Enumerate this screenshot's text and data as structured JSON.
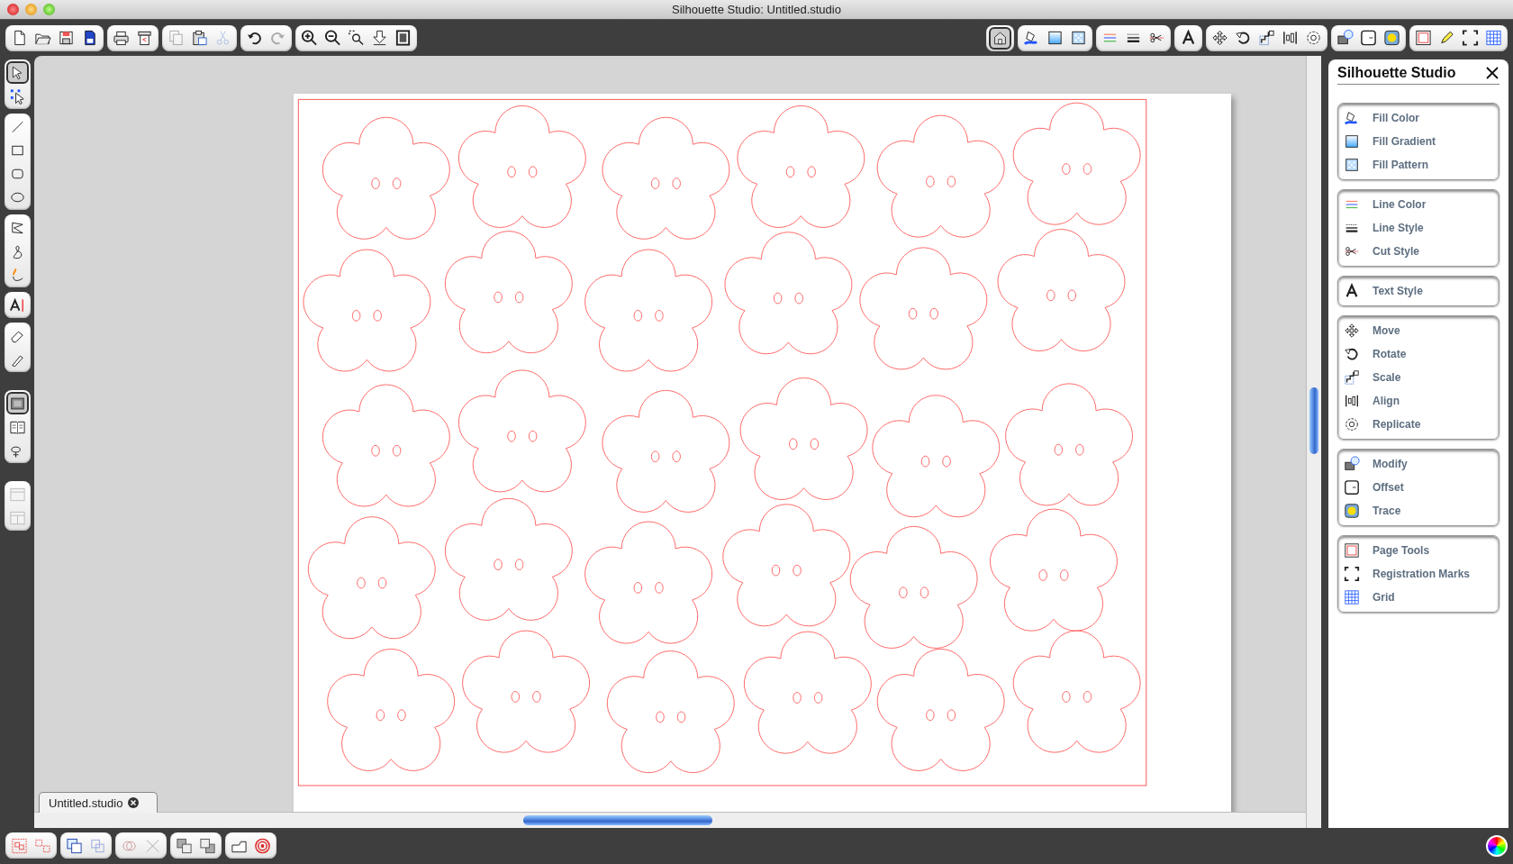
{
  "window": {
    "title": "Silhouette Studio: Untitled.studio"
  },
  "toolbar": {
    "left_groups": [
      [
        {
          "kind": "new",
          "disabled": false
        },
        {
          "kind": "open",
          "disabled": false
        },
        {
          "kind": "save",
          "disabled": false
        },
        {
          "kind": "card",
          "disabled": false
        }
      ],
      [
        {
          "kind": "print",
          "disabled": false
        },
        {
          "kind": "cutter",
          "disabled": false
        }
      ],
      [
        {
          "kind": "copy",
          "disabled": true
        },
        {
          "kind": "paste",
          "disabled": false
        },
        {
          "kind": "cut",
          "disabled": true
        }
      ],
      [
        {
          "kind": "undo",
          "disabled": false
        },
        {
          "kind": "redo",
          "disabled": true
        }
      ],
      [
        {
          "kind": "zoom-in",
          "disabled": false
        },
        {
          "kind": "zoom-out",
          "disabled": false
        },
        {
          "kind": "zoom-area",
          "disabled": false
        },
        {
          "kind": "pan",
          "disabled": false
        },
        {
          "kind": "fit",
          "disabled": false
        }
      ]
    ],
    "right_groups": [
      [
        {
          "kind": "home",
          "selected": true
        }
      ],
      [
        {
          "kind": "fill-color",
          "selected": false
        },
        {
          "kind": "fill-gradient",
          "selected": false
        },
        {
          "kind": "fill-pattern",
          "selected": false
        }
      ],
      [
        {
          "kind": "line-color",
          "selected": false
        },
        {
          "kind": "line-style",
          "selected": false
        },
        {
          "kind": "cut-style",
          "selected": false
        }
      ],
      [
        {
          "kind": "text-style",
          "selected": false
        }
      ],
      [
        {
          "kind": "move",
          "selected": false
        },
        {
          "kind": "rotate",
          "selected": false
        },
        {
          "kind": "scale",
          "selected": false
        },
        {
          "kind": "align",
          "selected": false
        },
        {
          "kind": "replicate",
          "selected": false
        }
      ],
      [
        {
          "kind": "modify",
          "selected": false
        },
        {
          "kind": "offset",
          "selected": false
        },
        {
          "kind": "trace",
          "selected": false
        }
      ],
      [
        {
          "kind": "page",
          "selected": false
        },
        {
          "kind": "pencil",
          "selected": false
        },
        {
          "kind": "reg-marks",
          "selected": false
        },
        {
          "kind": "grid",
          "selected": false
        }
      ]
    ]
  },
  "tools": [
    [
      {
        "kind": "pointer",
        "selected": true
      },
      {
        "kind": "edit-points",
        "selected": false
      }
    ],
    [
      {
        "kind": "line",
        "selected": false
      },
      {
        "kind": "rect",
        "selected": false
      },
      {
        "kind": "rounded-rect",
        "selected": false
      },
      {
        "kind": "ellipse",
        "selected": false
      }
    ],
    [
      {
        "kind": "polygon",
        "selected": false
      },
      {
        "kind": "curve",
        "selected": false
      },
      {
        "kind": "freehand",
        "selected": false
      }
    ],
    [
      {
        "kind": "text",
        "selected": false
      }
    ],
    [
      {
        "kind": "eraser",
        "selected": false
      },
      {
        "kind": "knife",
        "selected": false
      }
    ],
    [
      {
        "kind": "page-view",
        "selected": true
      },
      {
        "kind": "library",
        "selected": false
      },
      {
        "kind": "store",
        "selected": false
      }
    ],
    [
      {
        "kind": "split-h",
        "selected": false
      },
      {
        "kind": "split-v",
        "selected": false
      }
    ]
  ],
  "document_tab": {
    "label": "Untitled.studio",
    "selected": true
  },
  "panel": {
    "title": "Silhouette Studio",
    "groups": [
      [
        {
          "kind": "fill-color",
          "label": "Fill Color"
        },
        {
          "kind": "fill-gradient",
          "label": "Fill Gradient"
        },
        {
          "kind": "fill-pattern",
          "label": "Fill Pattern"
        }
      ],
      [
        {
          "kind": "line-color",
          "label": "Line Color"
        },
        {
          "kind": "line-style",
          "label": "Line Style"
        },
        {
          "kind": "cut-style",
          "label": "Cut Style"
        }
      ],
      [
        {
          "kind": "text-style",
          "label": "Text Style"
        }
      ],
      [
        {
          "kind": "move",
          "label": "Move"
        },
        {
          "kind": "rotate",
          "label": "Rotate"
        },
        {
          "kind": "scale",
          "label": "Scale"
        },
        {
          "kind": "align",
          "label": "Align"
        },
        {
          "kind": "replicate",
          "label": "Replicate"
        }
      ],
      [
        {
          "kind": "modify",
          "label": "Modify"
        },
        {
          "kind": "offset",
          "label": "Offset"
        },
        {
          "kind": "trace",
          "label": "Trace"
        }
      ],
      [
        {
          "kind": "page",
          "label": "Page Tools"
        },
        {
          "kind": "reg-marks",
          "label": "Registration Marks"
        },
        {
          "kind": "grid",
          "label": "Grid"
        }
      ]
    ]
  },
  "bottom_toolbar": [
    [
      {
        "kind": "group"
      },
      {
        "kind": "ungroup"
      }
    ],
    [
      {
        "kind": "compound"
      },
      {
        "kind": "release"
      }
    ],
    [
      {
        "kind": "weld"
      },
      {
        "kind": "delete"
      }
    ],
    [
      {
        "kind": "front"
      },
      {
        "kind": "back"
      }
    ],
    [
      {
        "kind": "shape"
      },
      {
        "kind": "target"
      }
    ]
  ]
}
